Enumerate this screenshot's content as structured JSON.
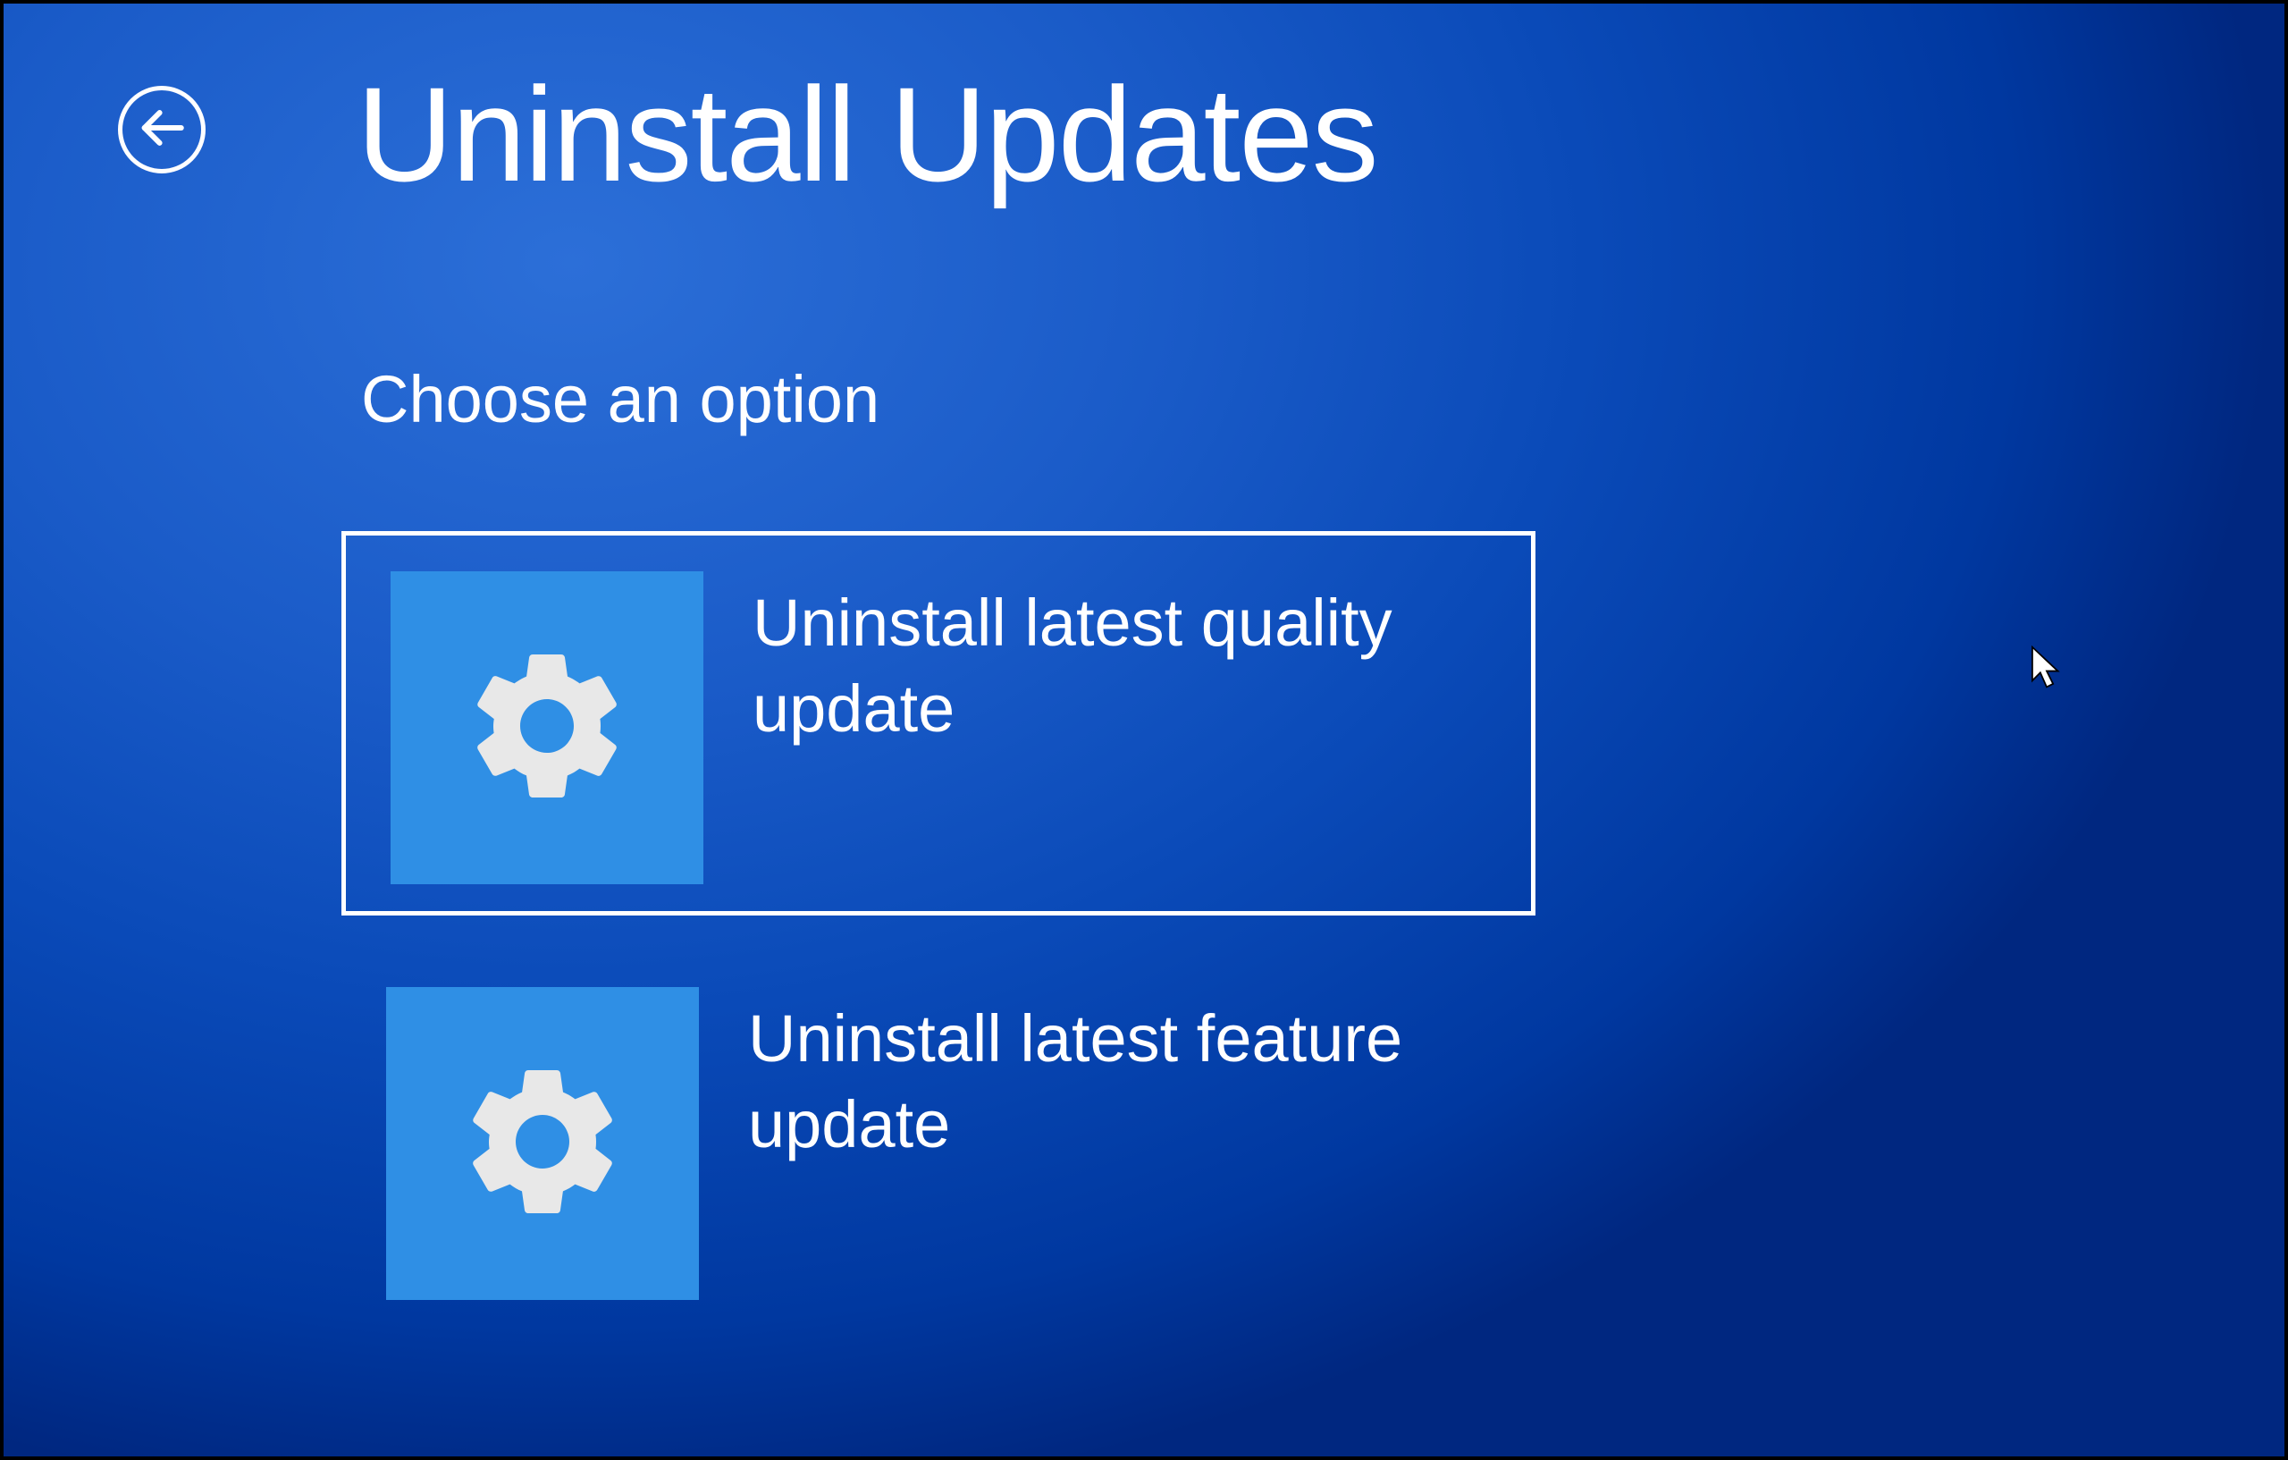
{
  "header": {
    "title": "Uninstall Updates"
  },
  "subtitle": "Choose an option",
  "options": {
    "quality": {
      "label": "Uninstall latest quality update",
      "icon": "gear-icon",
      "selected": true
    },
    "feature": {
      "label": "Uninstall latest feature update",
      "icon": "gear-icon",
      "selected": false
    }
  }
}
